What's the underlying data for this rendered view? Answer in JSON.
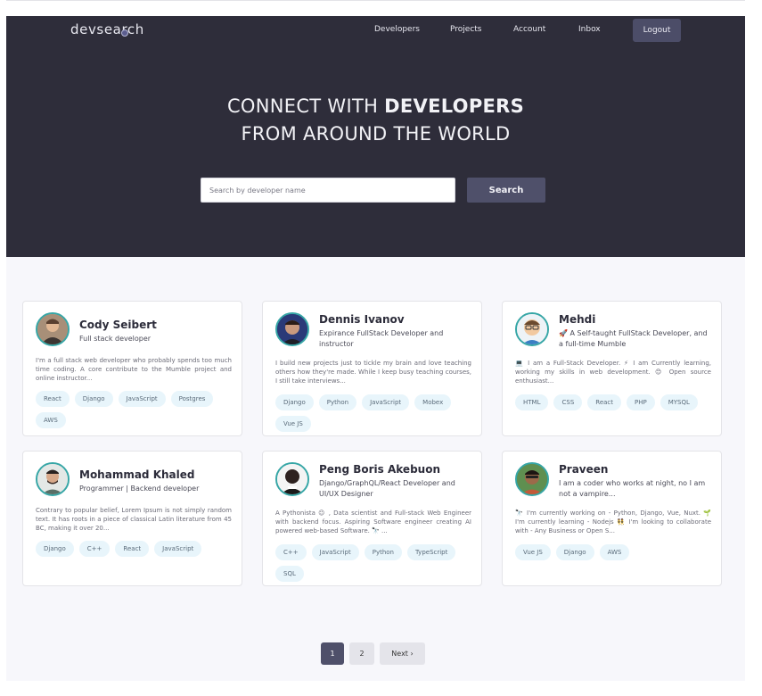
{
  "brand": {
    "logo": "devsearch"
  },
  "nav": {
    "developers": "Developers",
    "projects": "Projects",
    "account": "Account",
    "inbox": "Inbox",
    "logout": "Logout"
  },
  "hero": {
    "line1_light": "CONNECT WITH ",
    "line1_bold": "DEVELOPERS",
    "line2": "FROM AROUND THE WORLD"
  },
  "search": {
    "placeholder": "Search by developer name",
    "button": "Search"
  },
  "developers": [
    {
      "name": "Cody Seibert",
      "role": "Full stack developer",
      "bio": "I'm a full stack web developer who probably spends too much time coding. A core contribute to the Mumble project and online instructor...",
      "skills": [
        "React",
        "Django",
        "JavaScript",
        "Postgres",
        "AWS"
      ]
    },
    {
      "name": "Dennis Ivanov",
      "role": "Expirance FullStack Developer and instructor",
      "bio": "I build new projects just to tickle my brain and love teaching others how they're made. While I keep busy teaching courses, I still take interviews...",
      "skills": [
        "Django",
        "Python",
        "JavaScript",
        "Mobex",
        "Vue JS"
      ]
    },
    {
      "name": "Mehdi",
      "role": "🚀 A Self-taught FullStack Developer, and a full-time Mumble",
      "bio": "💻 I am a Full-Stack Developer. ⚡ I am Currently learning, working my skills in web development. 😊 Open source enthusiast...",
      "skills": [
        "HTML",
        "CSS",
        "React",
        "PHP",
        "MYSQL"
      ]
    },
    {
      "name": "Mohammad Khaled",
      "role": "Programmer | Backend developer",
      "bio": "Contrary to popular belief, Lorem Ipsum is not simply random text. It has roots in a piece of classical Latin literature from 45 BC, making it over 20...",
      "skills": [
        "Django",
        "C++",
        "React",
        "JavaScript"
      ]
    },
    {
      "name": "Peng Boris Akebuon",
      "role": "Django/GraphQL/React Developer and UI/UX Designer",
      "bio": "A Pythonista 😉 , Data scientist and Full-stack Web Engineer with backend focus. Aspiring Software engineer creating AI powered web-based Software. 🔭 ...",
      "skills": [
        "C++",
        "JavaScript",
        "Python",
        "TypeScript",
        "SQL"
      ]
    },
    {
      "name": "Praveen",
      "role": "I am a coder who works at night, no I am not a vampire...",
      "bio": "🔭 I'm currently working on - Python, Django, Vue, Nuxt. 🌱 I'm currently learning - Nodejs 👯 I'm looking to collaborate with - Any Business or Open S...",
      "skills": [
        "Vue JS",
        "Django",
        "AWS"
      ]
    }
  ],
  "pagination": {
    "page1": "1",
    "page2": "2",
    "next": "Next ›"
  },
  "colors": {
    "hero_bg": "#2e2d3a",
    "accent": "#4f506a",
    "tag_bg": "#e8f5fb",
    "avatar_ring": "#36a6a6"
  }
}
